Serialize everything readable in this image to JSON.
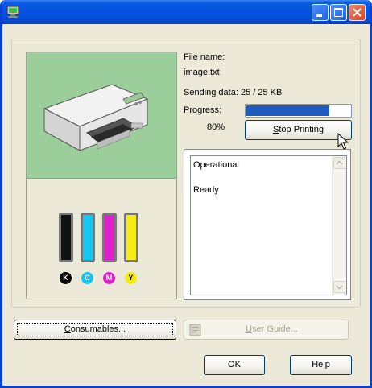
{
  "window": {
    "title": "",
    "accent": "#0553e0"
  },
  "file": {
    "label": "File name:",
    "value": "image.txt"
  },
  "sending": {
    "label": "Sending data: 25 / 25 KB"
  },
  "progress": {
    "label": "Progress:",
    "percent_text": "80%",
    "fraction": 0.8,
    "color": "#1e5bbf"
  },
  "buttons": {
    "stop_printing": {
      "underlined": "S",
      "rest": "top Printing"
    },
    "consumables": {
      "underlined": "C",
      "rest": "onsumables..."
    },
    "user_guide": {
      "underlined": "U",
      "rest": "ser Guide..."
    },
    "ok": "OK",
    "help": "Help"
  },
  "status": {
    "line1": "Operational",
    "line2": "Ready"
  },
  "inks": [
    {
      "letter": "K",
      "color": "#111111",
      "badge_bg": "#000000",
      "badge_fg": "#ffffff"
    },
    {
      "letter": "C",
      "color": "#16c6f0",
      "badge_bg": "#16c6f0",
      "badge_fg": "#ffffff"
    },
    {
      "letter": "M",
      "color": "#e020c8",
      "badge_bg": "#e020c8",
      "badge_fg": "#ffffff"
    },
    {
      "letter": "Y",
      "color": "#f6ec10",
      "badge_bg": "#f6ec10",
      "badge_fg": "#000000"
    }
  ],
  "icons": {
    "app": "printer-monitor-icon",
    "user_guide": "book-icon",
    "cursor": "mouse-pointer-icon"
  }
}
